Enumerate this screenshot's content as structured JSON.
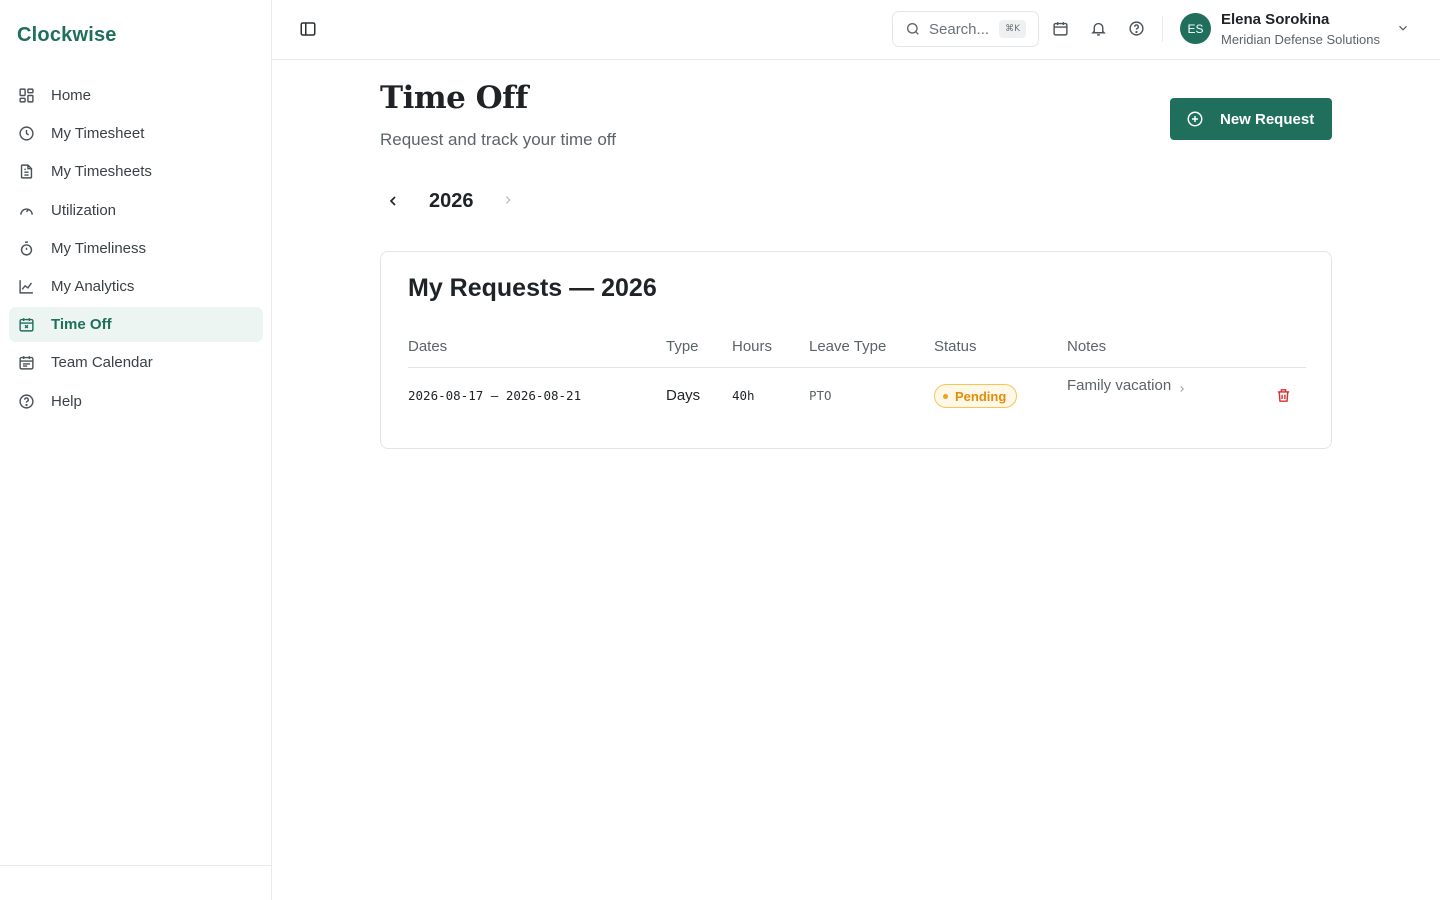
{
  "brand": "Clockwise",
  "sidebar": {
    "items": [
      {
        "label": "Home",
        "icon": "grid-icon"
      },
      {
        "label": "My Timesheet",
        "icon": "clock-icon"
      },
      {
        "label": "My Timesheets",
        "icon": "document-icon"
      },
      {
        "label": "Utilization",
        "icon": "gauge-icon"
      },
      {
        "label": "My Timeliness",
        "icon": "stopwatch-icon"
      },
      {
        "label": "My Analytics",
        "icon": "line-chart-icon"
      },
      {
        "label": "Time Off",
        "icon": "calendar-x-icon",
        "active": true
      },
      {
        "label": "Team Calendar",
        "icon": "calendar-list-icon"
      },
      {
        "label": "Help",
        "icon": "help-circle-icon"
      }
    ]
  },
  "header": {
    "search_placeholder": "Search...",
    "search_shortcut": "⌘K",
    "user": {
      "initials": "ES",
      "name": "Elena Sorokina",
      "org": "Meridian Defense Solutions"
    }
  },
  "page": {
    "title": "Time Off",
    "subtitle": "Request and track your time off",
    "new_request_label": "New Request",
    "year": "2026"
  },
  "requests": {
    "title": "My Requests — 2026",
    "columns": [
      "Dates",
      "Type",
      "Hours",
      "Leave Type",
      "Status",
      "Notes"
    ],
    "rows": [
      {
        "dates": "2026-08-17 – 2026-08-21",
        "type": "Days",
        "hours": "40h",
        "leave_type": "PTO",
        "status": "Pending",
        "notes": "Family vacation"
      }
    ]
  },
  "colors": {
    "accent": "#1f6f5c",
    "active_bg": "#ecf5f2",
    "pending": "#e08d0a",
    "danger": "#d62f2f"
  }
}
